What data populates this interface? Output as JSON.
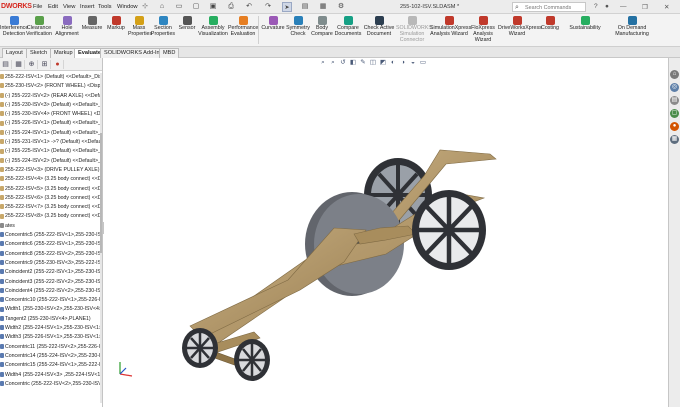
{
  "app": {
    "logo": "DWORKS",
    "menu": [
      "File",
      "Edit",
      "View",
      "Insert",
      "Tools",
      "Window"
    ],
    "document_title": "255-102-ISV.SLDASM *",
    "search_placeholder": "Search Commands"
  },
  "ribbon": {
    "buttons": [
      {
        "label": "Interference\nDetection",
        "icon": "interference-icon",
        "color": "#3a7bd5"
      },
      {
        "label": "Clearance\nVerification",
        "icon": "clearance-icon",
        "color": "#5aa04a"
      },
      {
        "label": "Hole\nAlignment",
        "icon": "hole-alignment-icon",
        "color": "#8a6bbf"
      },
      {
        "label": "Measure",
        "icon": "measure-icon",
        "color": "#666666"
      },
      {
        "label": "Markup",
        "icon": "markup-icon",
        "color": "#c0392b"
      },
      {
        "label": "Mass\nProperties",
        "icon": "mass-properties-icon",
        "color": "#d4a017"
      },
      {
        "label": "Section\nProperties",
        "icon": "section-properties-icon",
        "color": "#2e86c1"
      },
      {
        "label": "Sensor",
        "icon": "sensor-icon",
        "color": "#555555"
      },
      {
        "label": "Assembly\nVisualization",
        "icon": "assembly-visualization-icon",
        "color": "#27ae60"
      },
      {
        "label": "Performance\nEvaluation",
        "icon": "performance-icon",
        "color": "#e67e22"
      },
      {
        "label": "Curvature",
        "icon": "curvature-icon",
        "color": "#9b59b6"
      },
      {
        "label": "Symmetry\nCheck",
        "icon": "symmetry-icon",
        "color": "#2980b9"
      },
      {
        "label": "Body\nCompare",
        "icon": "body-compare-icon",
        "color": "#7f8c8d"
      },
      {
        "label": "Compare\nDocuments",
        "icon": "compare-documents-icon",
        "color": "#16a085"
      },
      {
        "label": "Check Active\nDocument",
        "icon": "check-active-icon",
        "color": "#2c3e50"
      },
      {
        "label": "SOLIDWORKS\nSimulation\nConnector",
        "icon": "simulation-connector-icon",
        "color": "#b8b8b8",
        "dim": true
      },
      {
        "label": "SimulationXpress\nAnalysis Wizard",
        "icon": "simulationxpress-icon",
        "color": "#c0392b"
      },
      {
        "label": "FloXpress\nAnalysis\nWizard",
        "icon": "floxpress-icon",
        "color": "#c0392b"
      },
      {
        "label": "DriveWorksXpress\nWizard",
        "icon": "driveworksxpress-icon",
        "color": "#c0392b"
      },
      {
        "label": "Costing",
        "icon": "costing-icon",
        "color": "#c0392b"
      },
      {
        "label": "Sustainability",
        "icon": "sustainability-icon",
        "color": "#27ae60"
      },
      {
        "label": "On Demand\nManufacturing",
        "icon": "on-demand-manufacturing-icon",
        "color": "#2471a3"
      }
    ]
  },
  "tabs": [
    {
      "label": "Layout",
      "active": false
    },
    {
      "label": "Sketch",
      "active": false
    },
    {
      "label": "Markup",
      "active": false
    },
    {
      "label": "Evaluate",
      "active": true
    },
    {
      "label": "SOLIDWORKS Add-Ins",
      "active": false
    },
    {
      "label": "MBD",
      "active": false
    }
  ],
  "tree": {
    "items": [
      {
        "text": "255-222-ISV<1> (Default) <<Default>_Displ",
        "color": "#c8a86a"
      },
      {
        "text": "255-230-ISV<2> (FRONT WHEEL) <Display S",
        "color": "#c8a86a"
      },
      {
        "text": "(-) 255-222-ISV<2> (REAR AXLE) <<Defaul",
        "color": "#c8a86a"
      },
      {
        "text": "(-) 255-230-ISV<3> (Default) <<Default>_",
        "color": "#c8a86a"
      },
      {
        "text": "(-) 255-230-ISV<4> (FRONT WHEEL) <Display",
        "color": "#c8a86a"
      },
      {
        "text": "(-) 255-226-ISV<1> (Default) <<Default>_",
        "color": "#c8a86a"
      },
      {
        "text": "(-) 255-224-ISV<1> (Default) <<Default>_",
        "color": "#c8a86a"
      },
      {
        "text": "(-) 255-231-ISV<1> ->? (Default) <<Defau",
        "color": "#c8a86a"
      },
      {
        "text": "(-) 255-225-ISV<1> (Default) <<Default>_",
        "color": "#c8a86a"
      },
      {
        "text": "(-) 255-224-ISV<2> (Default) <<Default>_",
        "color": "#c8a86a"
      },
      {
        "text": "255-222-ISV<3> (DRIVE PULLEY AXLE) <<De",
        "color": "#c8a86a"
      },
      {
        "text": "255-222-ISV<4> (3.25 body connect) <<Def",
        "color": "#c8a86a"
      },
      {
        "text": "255-222-ISV<5> (3.25 body connect) <<Def",
        "color": "#c8a86a"
      },
      {
        "text": "255-222-ISV<6> (3.25 body connect) <<Def",
        "color": "#c8a86a"
      },
      {
        "text": "255-222-ISV<7> (3.25 body connect) <<Def",
        "color": "#c8a86a"
      },
      {
        "text": "255-222-ISV<8> (3.25 body connect) <<Def",
        "color": "#c8a86a"
      },
      {
        "text": "ates",
        "color": "#8a8a8a"
      },
      {
        "text": "Concentric5 (255-222-ISV<1>,255-230-ISV",
        "color": "#5a7ab0"
      },
      {
        "text": "Concentric6 (255-222-ISV<1>,255-230-ISV",
        "color": "#5a7ab0"
      },
      {
        "text": "Concentric8 (255-222-ISV<2>,255-230-ISV",
        "color": "#5a7ab0"
      },
      {
        "text": "Concentric9 (255-230-ISV<3>,255-222-ISV",
        "color": "#5a7ab0"
      },
      {
        "text": "Coincident2 (255-222-ISV<1>,255-230-ISV",
        "color": "#5a7ab0"
      },
      {
        "text": "Coincident3 (255-222-ISV<2>,255-230-ISV",
        "color": "#5a7ab0"
      },
      {
        "text": "Coincident4 (255-222-ISV<2>,255-230-ISV",
        "color": "#5a7ab0"
      },
      {
        "text": "Concentric10 (255-222-ISV<1>,255-226-ISV",
        "color": "#5a7ab0"
      },
      {
        "text": "Width1 (255-230-ISV<2>,255-230-ISV<4>,",
        "color": "#5a7ab0"
      },
      {
        "text": "Tangent2 (255-230-ISV<4>,PLANE1)",
        "color": "#5a7ab0"
      },
      {
        "text": "Width2 (255-224-ISV<1>,255-230-ISV<1>,",
        "color": "#5a7ab0"
      },
      {
        "text": "Width3 (255-226-ISV<1>,255-230-ISV<1>,",
        "color": "#5a7ab0"
      },
      {
        "text": "Concentric11 (255-222-ISV<2>,255-226-ISV",
        "color": "#5a7ab0"
      },
      {
        "text": "Concentric14 (255-224-ISV<2>,255-230-ISV",
        "color": "#5a7ab0"
      },
      {
        "text": "Concentric15 (255-224-ISV<1>,255-222-ISV",
        "color": "#5a7ab0"
      },
      {
        "text": "Width4 (255-224-ISV<3> ,255-224-ISV<1>",
        "color": "#5a7ab0"
      },
      {
        "text": "Concentric (255-222-ISV<2>,255-230-ISV",
        "color": "#5a7ab0"
      }
    ]
  },
  "hud_icons": [
    "zoom-to-fit-icon",
    "zoom-area-icon",
    "previous-view-icon",
    "section-view-icon",
    "dynamic-annotation-icon",
    "view-orientation-icon",
    "display-style-icon",
    "hide-show-icon",
    "edit-appearance-icon",
    "apply-scene-icon",
    "view-settings-icon"
  ],
  "taskpane": [
    {
      "icon": "home-icon",
      "color": "#7a7a7a"
    },
    {
      "icon": "resources-icon",
      "color": "#5d7fa8"
    },
    {
      "icon": "design-library-icon",
      "color": "#8a8a8a"
    },
    {
      "icon": "file-explorer-icon",
      "color": "#4a8c4a"
    },
    {
      "icon": "appearances-icon",
      "color": "#d35400"
    },
    {
      "icon": "custom-properties-icon",
      "color": "#5d6d7e"
    }
  ],
  "colors": {
    "wood": "#b59a6b",
    "wood_dark": "#7f6a44",
    "wheel": "#3d3f44",
    "pulley": "#5f6168"
  }
}
